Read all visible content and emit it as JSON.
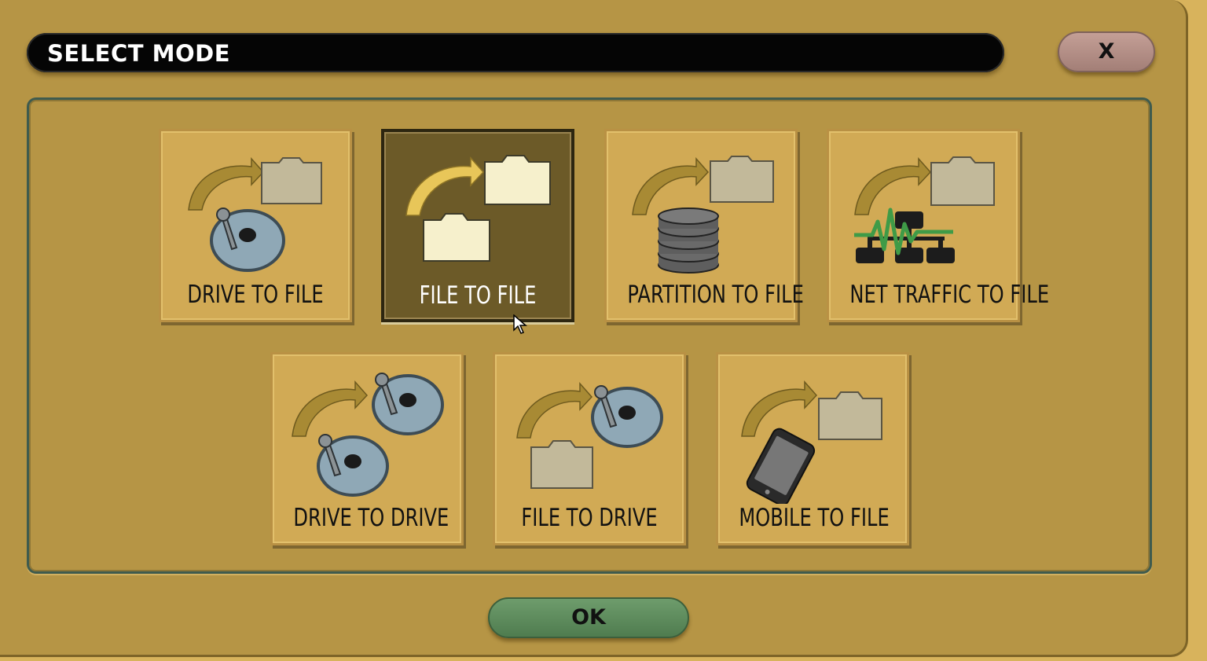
{
  "dialog": {
    "title": "SELECT MODE",
    "close_label": "X",
    "ok_label": "OK"
  },
  "modes": [
    {
      "label": "DRIVE TO FILE",
      "icon": "drive-to-file-icon",
      "selected": false
    },
    {
      "label": "FILE TO FILE",
      "icon": "file-to-file-icon",
      "selected": true
    },
    {
      "label": "PARTITION TO FILE",
      "icon": "partition-to-file-icon",
      "selected": false
    },
    {
      "label": "NET TRAFFIC TO FILE",
      "icon": "net-traffic-to-file-icon",
      "selected": false
    },
    {
      "label": "DRIVE TO DRIVE",
      "icon": "drive-to-drive-icon",
      "selected": false
    },
    {
      "label": "FILE TO DRIVE",
      "icon": "file-to-drive-icon",
      "selected": false
    },
    {
      "label": "MOBILE TO FILE",
      "icon": "mobile-to-file-icon",
      "selected": false
    }
  ],
  "colors": {
    "window": "#b69545",
    "tile": "#d1aa55",
    "tile_selected": "#6c5a28",
    "title_bar": "#050505",
    "close_button": "#b38f87",
    "ok_button": "#5f8c5e",
    "arrow": "#a88a34",
    "arrow_selected": "#e8c659",
    "folder": "#c2b99a",
    "folder_selected": "#f6f0cc",
    "disk": "#8fa8b6",
    "net_line": "#3f9b47"
  }
}
